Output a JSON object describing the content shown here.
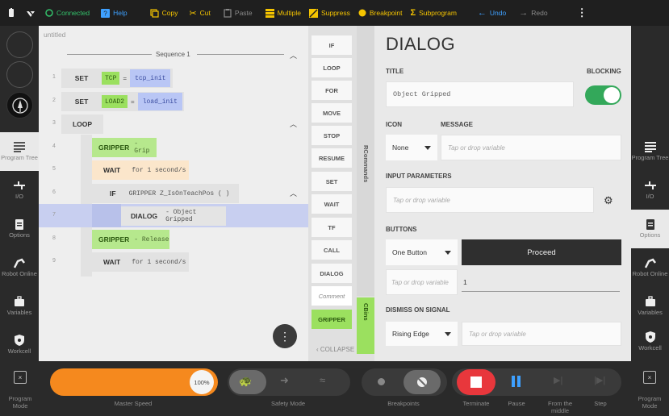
{
  "toolbar": {
    "connected": "Connected",
    "help": "Help",
    "copy": "Copy",
    "cut": "Cut",
    "paste": "Paste",
    "multiple": "Multiple",
    "suppress": "Suppress",
    "breakpoint": "Breakpoint",
    "subprogram": "Subprogram",
    "undo": "Undo",
    "redo": "Redo"
  },
  "left_nav": [
    {
      "label": "Program Tree",
      "icon": "list-icon",
      "active": true
    },
    {
      "label": "I/O",
      "icon": "io-icon"
    },
    {
      "label": "Options",
      "icon": "clipboard-icon"
    },
    {
      "label": "Robot Online",
      "icon": "robot-arm-icon"
    },
    {
      "label": "Variables",
      "icon": "briefcase-icon"
    },
    {
      "label": "Workcell",
      "icon": "shield-icon"
    }
  ],
  "right_nav": [
    {
      "label": "Program Tree",
      "icon": "list-icon"
    },
    {
      "label": "I/O",
      "icon": "io-icon"
    },
    {
      "label": "Options",
      "icon": "clipboard-icon",
      "active": true
    },
    {
      "label": "Robot Online",
      "icon": "robot-arm-icon"
    },
    {
      "label": "Variables",
      "icon": "briefcase-icon"
    },
    {
      "label": "Workcell",
      "icon": "shield-icon"
    }
  ],
  "program": {
    "name": "untitled",
    "sequence_label": "Sequence 1",
    "rows": [
      {
        "num": "1",
        "cmd": "SET",
        "tag": "TCP",
        "eq": "=",
        "value": "tcp_init"
      },
      {
        "num": "2",
        "cmd": "SET",
        "tag": "LOAD2",
        "eq": "=",
        "value": "load_init"
      },
      {
        "num": "3",
        "cmd": "LOOP"
      },
      {
        "num": "4",
        "cmd": "GRIPPER",
        "detail": "- Grip"
      },
      {
        "num": "5",
        "cmd": "WAIT",
        "detail": "for 1 second/s"
      },
      {
        "num": "6",
        "cmd": "IF",
        "detail": "GRIPPER Z_IsOnTeachPos ( )"
      },
      {
        "num": "7",
        "cmd": "DIALOG",
        "detail": "- Object Gripped"
      },
      {
        "num": "8",
        "cmd": "GRIPPER",
        "detail": "- Release"
      },
      {
        "num": "9",
        "cmd": "WAIT",
        "detail": "for 1 second/s"
      }
    ],
    "fab_icon": "more-vertical-icon"
  },
  "commands": {
    "items": [
      "IF",
      "LOOP",
      "FOR",
      "MOVE",
      "STOP",
      "RESUME",
      "SET",
      "WAIT",
      "TF",
      "CALL",
      "DIALOG",
      "Comment",
      "GRIPPER"
    ],
    "rcommands_label": "RCommands",
    "cbins_label": "CBins",
    "collapse": "COLLAPSE"
  },
  "dialog": {
    "heading": "DIALOG",
    "title_label": "TITLE",
    "blocking_label": "BLOCKING",
    "blocking_on": true,
    "title_value": "Object Gripped",
    "icon_label": "ICON",
    "message_label": "MESSAGE",
    "icon_value": "None",
    "message_placeholder": "Tap or drop variable",
    "input_params_label": "INPUT PARAMETERS",
    "input_params_placeholder": "Tap or drop variable",
    "buttons_label": "BUTTONS",
    "buttons_value": "One Button",
    "proceed": "Proceed",
    "button_var_placeholder": "Tap or drop variable",
    "button_num": "1",
    "dismiss_label": "DISMISS ON SIGNAL",
    "dismiss_value": "Rising Edge",
    "dismiss_placeholder": "Tap or drop variable"
  },
  "bottom": {
    "program_mode": "Program Mode",
    "speed_value": "100%",
    "speed_fraction": 1.0,
    "master_speed": "Master Speed",
    "safety_mode": "Safety Mode",
    "breakpoints": "Breakpoints",
    "terminate": "Terminate",
    "pause": "Pause",
    "from_middle": "From the middle",
    "step": "Step",
    "colors": {
      "speed": "#f5891e",
      "terminate": "#e8373c",
      "pause": "#3ea0ff"
    }
  }
}
